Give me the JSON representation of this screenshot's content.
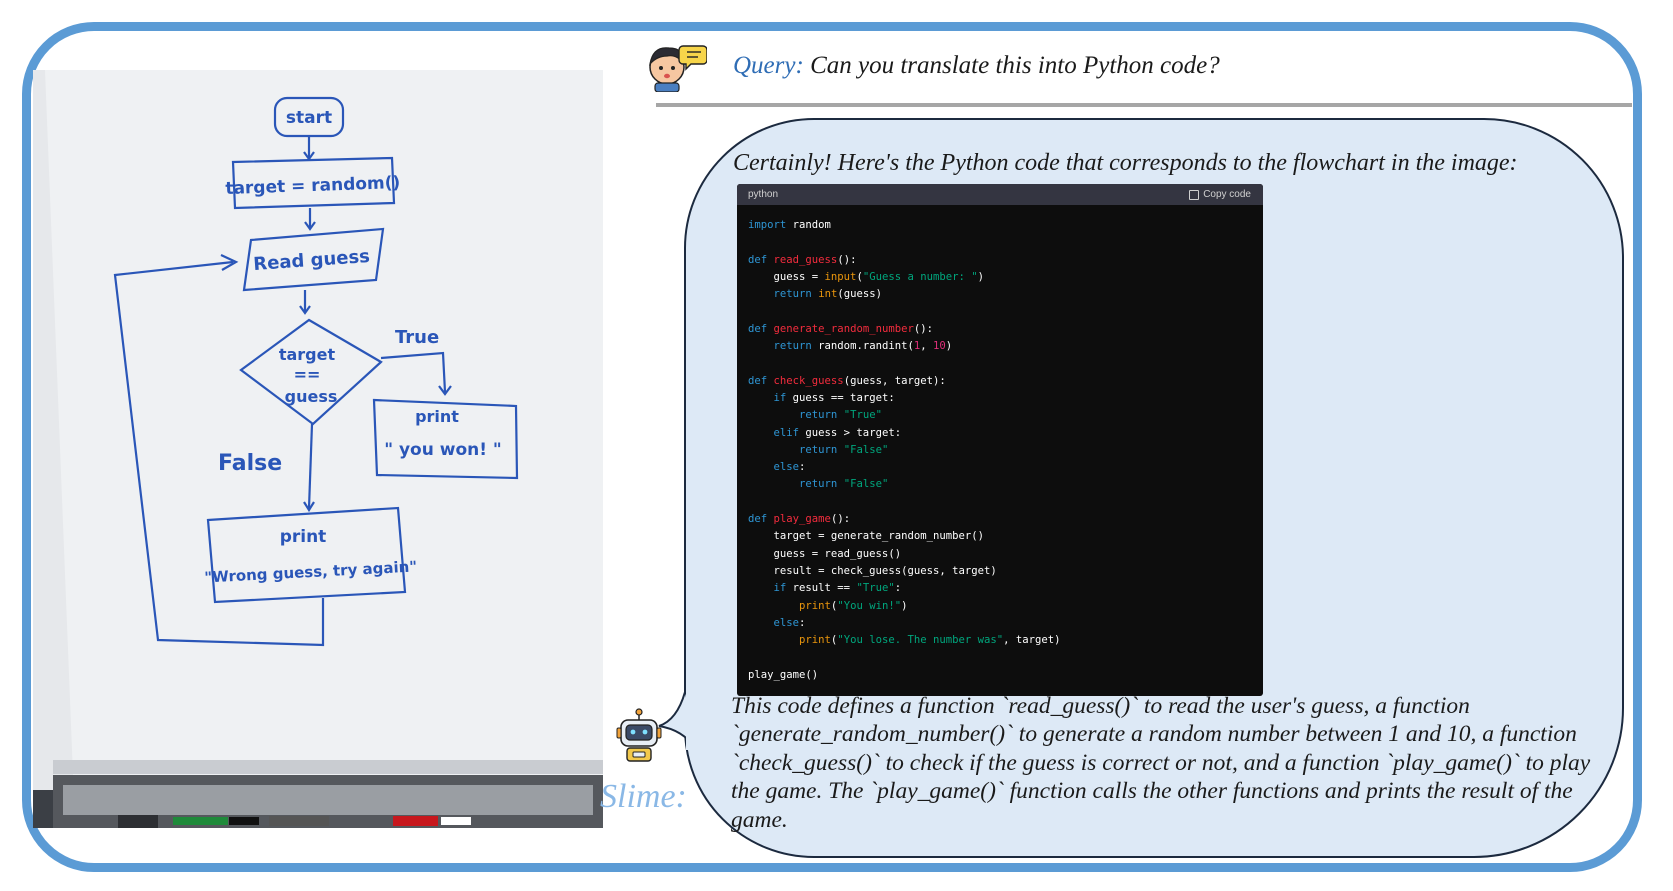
{
  "query": {
    "label": "Query:",
    "text": "Can you translate this into Python code?"
  },
  "flowchart": {
    "start": "start",
    "assign": "target = random()",
    "read": "Read guess",
    "cond_1": "target",
    "cond_2": "==",
    "cond_3": "guess",
    "true_label": "True",
    "false_label": "False",
    "win_1": "print",
    "win_2": "\" you won! \"",
    "lose_1": "print",
    "lose_2": "\"Wrong guess, try again\""
  },
  "response": {
    "intro": "Certainly! Here's the Python code that corresponds to the flowchart in the image:",
    "code_lang": "python",
    "copy_label": "Copy code",
    "explanation": "This code defines a function `read_guess()` to read the user's guess, a function `generate_random_number()` to generate a random number between 1 and 10, a function `check_guess()` to check if the guess is correct or not, and a function `play_game()` to play the game. The `play_game()` function calls the other functions and prints the result of the game."
  },
  "bot": {
    "name": "Slime:"
  },
  "colors": {
    "frame": "#5b9bd5",
    "bubble": "#dde9f6",
    "query_label": "#2f6db5",
    "bot_name": "#8ab8e6",
    "code_bg": "#0d0d0d"
  },
  "icons": [
    "user-avatar-icon",
    "robot-avatar-icon",
    "copy-icon"
  ]
}
